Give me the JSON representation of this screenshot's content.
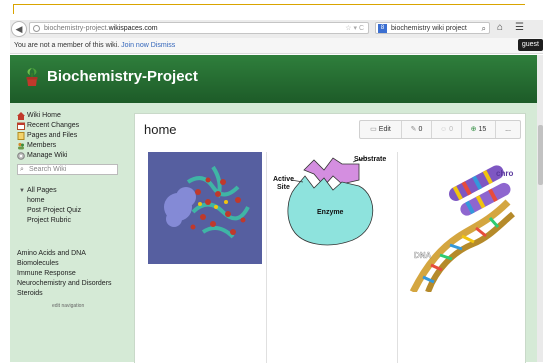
{
  "browser": {
    "url_prefix": "biochemistry-project.",
    "url_host": "wikispaces.com",
    "url_icons": "☆ ▾ C",
    "search_engine_letter": "8",
    "search_text": "biochemistry wiki project",
    "home_icon": "home-icon",
    "menu_icon": "menu-icon"
  },
  "memberbar": {
    "text": "You are not a member of this wiki.",
    "join_label": "Join now",
    "dismiss_label": "Dismiss",
    "guest_label": "guest"
  },
  "header": {
    "title": "Biochemistry-Project",
    "brand_color": "#2f7f3c"
  },
  "sidebar": {
    "nav": [
      {
        "label": "Wiki Home",
        "icon": "home-icon"
      },
      {
        "label": "Recent Changes",
        "icon": "calendar-icon"
      },
      {
        "label": "Pages and Files",
        "icon": "pages-icon"
      },
      {
        "label": "Members",
        "icon": "members-icon"
      },
      {
        "label": "Manage Wiki",
        "icon": "manage-icon"
      }
    ],
    "search_placeholder": "Search Wiki",
    "all_pages_label": "All Pages",
    "pages": [
      "home",
      "Post Project Quiz",
      "Project Rubric"
    ],
    "topics": [
      "Amino Acids and DNA",
      "Biomolecules",
      "Immune Response",
      "Neurochemistry and Disorders",
      "Steroids"
    ],
    "edit_navigation": "edit navigation"
  },
  "content": {
    "page_title": "home",
    "actions": {
      "edit_label": "Edit",
      "comments_count": "0",
      "likes_count": "0",
      "watch_count": "15",
      "more_label": "..."
    },
    "figures": {
      "enzyme_substrate": "Substrate",
      "enzyme_active": "Active",
      "enzyme_site": "Site",
      "enzyme_label": "Enzyme",
      "dna_label": "DNA",
      "chromosome_label": "chro"
    }
  }
}
